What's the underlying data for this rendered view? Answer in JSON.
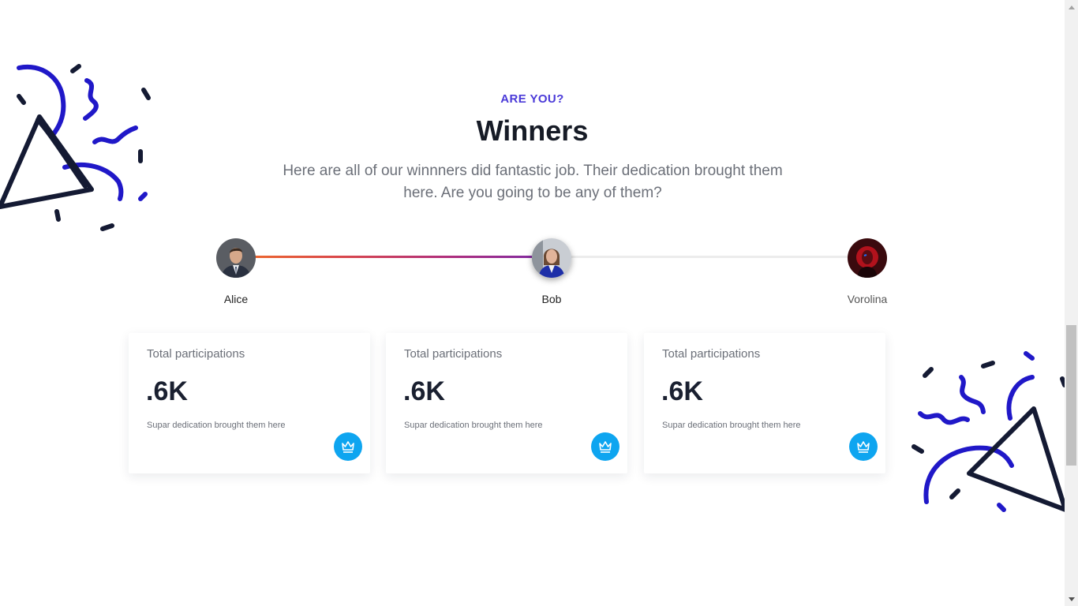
{
  "header": {
    "eyebrow": "ARE YOU?",
    "title": "Winners",
    "subtitle": "Here are all of our winnners did fantastic job. Their dedication brought them here. Are you going to be any of them?"
  },
  "timeline": {
    "progress_fraction": 0.5,
    "gradient_colors": [
      "#ef6c2a",
      "#d9474b",
      "#b02f7c",
      "#7b2aa6"
    ],
    "track_color": "#ececec",
    "winners": [
      {
        "name": "Alice",
        "active": false
      },
      {
        "name": "Bob",
        "active": true
      },
      {
        "name": "Vorolina",
        "active": false
      }
    ]
  },
  "cards": [
    {
      "label": "Total participations",
      "value": ".6K",
      "description": "Supar dedication brought them here",
      "icon": "crown-icon"
    },
    {
      "label": "Total participations",
      "value": ".6K",
      "description": "Supar dedication brought them here",
      "icon": "crown-icon"
    },
    {
      "label": "Total participations",
      "value": ".6K",
      "description": "Supar dedication brought them here",
      "icon": "crown-icon"
    }
  ],
  "colors": {
    "accent": "#4a3ad8",
    "badge": "#0ea5f0",
    "confetti_blue": "#2018c8",
    "confetti_dark": "#141a33"
  }
}
